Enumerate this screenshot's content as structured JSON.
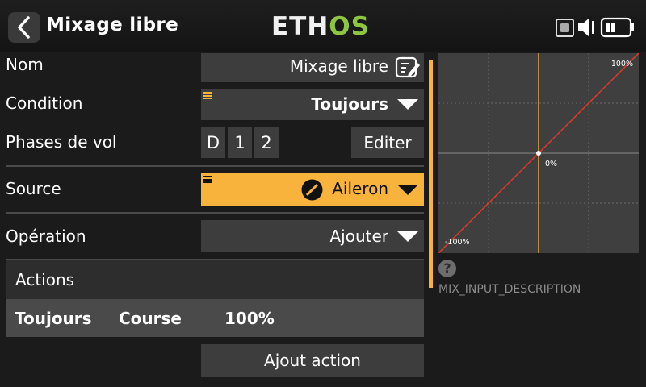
{
  "header": {
    "title": "Mixage libre",
    "logo_left": "ETH",
    "logo_right": "OS",
    "accent_color": "#8dc63f"
  },
  "form": {
    "name_label": "Nom",
    "name_value": "Mixage libre",
    "condition_label": "Condition",
    "condition_value": "Toujours",
    "flight_modes_label": "Phases de vol",
    "flight_modes": [
      "D",
      "1",
      "2"
    ],
    "edit_label": "Editer",
    "source_label": "Source",
    "source_value": "Aileron",
    "operation_label": "Opération",
    "operation_value": "Ajouter"
  },
  "actions": {
    "header": "Actions",
    "row": {
      "condition": "Toujours",
      "type": "Course",
      "value": "100%"
    },
    "add_label": "Ajout action"
  },
  "curve": {
    "top_right_label": "100%",
    "center_label": "0%",
    "bottom_left_label": "-100%",
    "description": "MIX_INPUT_DESCRIPTION",
    "help_glyph": "?"
  },
  "colors": {
    "orange": "#f8b33c",
    "field": "#3d3d3d",
    "curve_line": "#e03a2a"
  }
}
